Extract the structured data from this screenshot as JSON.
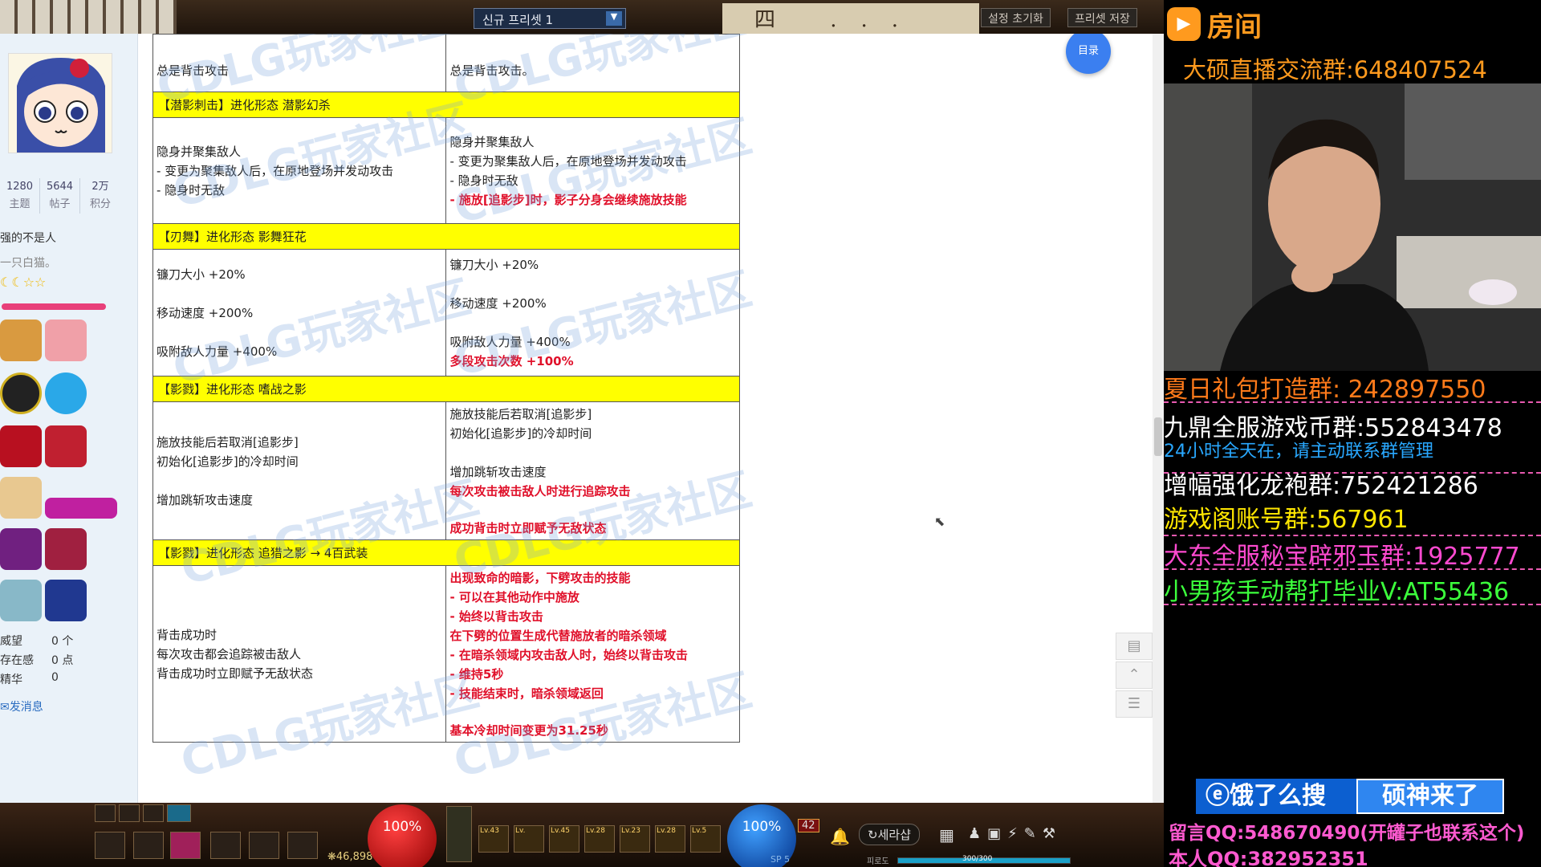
{
  "game_top": {
    "preset_label": "신규 프리셋 1",
    "calligraphy": "四 ... 流",
    "btn_reset": "설정 초기화",
    "btn_save": "프리셋 저장"
  },
  "profile": {
    "stats": [
      {
        "value": "1280",
        "label": "主题"
      },
      {
        "value": "5644",
        "label": "帖子"
      },
      {
        "value": "2万",
        "label": "积分"
      }
    ],
    "signature1": "强的不是人",
    "signature2": "一只白猫。",
    "stars": "☾☾☆☆",
    "medals": [
      "monkey-medal",
      "character-medal",
      "21-medal",
      "buzhi-medal",
      "conquer-medal",
      "girl-medal",
      "cake-medal",
      "sword-medal",
      "skill-medal-1",
      "skill-medal-2",
      "skill-medal-3",
      "skill-medal-4"
    ],
    "weiwang_label": "威望",
    "weiwang_value": "0 个",
    "cunzai_label": "存在感",
    "cunzai_value": "0 点",
    "jinghua_label": "精华",
    "jinghua_value": "0",
    "message_link": "发消息"
  },
  "watermark": "CDLG玩家社区",
  "article": {
    "top_row": {
      "left": "总是背击攻击",
      "right": "总是背击攻击。"
    },
    "sections": [
      {
        "header": "【潜影刺击】进化形态 潜影幻杀",
        "left": [
          "隐身并聚集敌人",
          "- 变更为聚集敌人后，在原地登场并发动攻击",
          "- 隐身时无敌"
        ],
        "right": [
          "隐身并聚集敌人",
          "- 变更为聚集敌人后，在原地登场并发动攻击",
          "- 隐身时无敌"
        ],
        "right_red": [
          "- 施放[追影步]时，影子分身会继续施放技能"
        ]
      },
      {
        "header": "【刃舞】进化形态 影舞狂花",
        "left": [
          "镰刀大小 +20%",
          "",
          "移动速度 +200%",
          "",
          "吸附敌人力量 +400%"
        ],
        "right": [
          "镰刀大小 +20%",
          "",
          "移动速度 +200%",
          "",
          "吸附敌人力量 +400%"
        ],
        "right_red": [
          "多段攻击次数 +100%"
        ]
      },
      {
        "header": "【影戮】进化形态 嗜战之影",
        "left": [
          "施放技能后若取消[追影步]",
          "初始化[追影步]的冷却时间",
          "",
          "增加跳斩攻击速度"
        ],
        "right": [
          "施放技能后若取消[追影步]",
          "初始化[追影步]的冷却时间",
          "",
          "增加跳斩攻击速度"
        ],
        "right_red": [
          "每次攻击被击敌人时进行追踪攻击",
          "",
          "成功背击时立即赋予无敌状态"
        ]
      },
      {
        "header": "【影戮】进化形态 追猎之影 → 4百武装",
        "left": [
          "背击成功时",
          "每次攻击都会追踪被击敌人",
          "背击成功时立即赋予无敌状态"
        ],
        "right": [],
        "right_red": [
          "出现致命的暗影，下劈攻击的技能",
          "- 可以在其他动作中施放",
          "- 始终以背击攻击",
          "在下劈的位置生成代替施放者的暗杀领域",
          "- 在暗杀领域内攻击敌人时，始终以背击攻击",
          "- 维持5秒",
          "- 技能结束时，暗杀领域返回",
          "",
          "基本冷却时间变更为31.25秒"
        ]
      }
    ]
  },
  "toc_button": "目录",
  "game_bar": {
    "hp_percent": "100%",
    "mp_percent": "100%",
    "gold": "46,898",
    "level_badge": "42",
    "channel": "세라샵",
    "sp_label": "SP 5",
    "exp_label": "피로도",
    "fatigue": "300/300",
    "skill_levels": [
      "Lv.43",
      "Lv.",
      "Lv.45",
      "Lv.28",
      "Lv.23",
      "Lv.28",
      "Lv.5"
    ]
  },
  "stream": {
    "room_title": "房间",
    "group_main": "大硕直播交流群:648407524",
    "lines": [
      {
        "text": "夏日礼包打造群: 242897550",
        "color": "#ff7a1a"
      },
      {
        "text": "九鼎全服游戏币群:552843478",
        "color": "#ffffff"
      },
      {
        "text": "24小时全天在，请主动联系群管理",
        "color": "#29a8ff"
      },
      {
        "text": "增幅强化龙袍群:752421286",
        "color": "#ffffff"
      },
      {
        "text": "游戏阁账号群:567961",
        "color": "#ffe600"
      },
      {
        "text": "大东全服秘宝辟邪玉群:1925777",
        "color": "#ff4ad0"
      },
      {
        "text": "小男孩手动帮打毕业V:AT55436",
        "color": "#3cff3c"
      }
    ],
    "search_left": "饿了么搜",
    "search_right": "硕神来了",
    "qq_msg": "留言QQ:548670490(开罐子也联系这个)",
    "qq_self": "本人QQ:382952351"
  },
  "colors": {
    "header_yellow": "#ffff00",
    "red_text": "#e0102a",
    "accent_blue": "#3b7ff0",
    "stream_orange": "#ff9a1e"
  }
}
